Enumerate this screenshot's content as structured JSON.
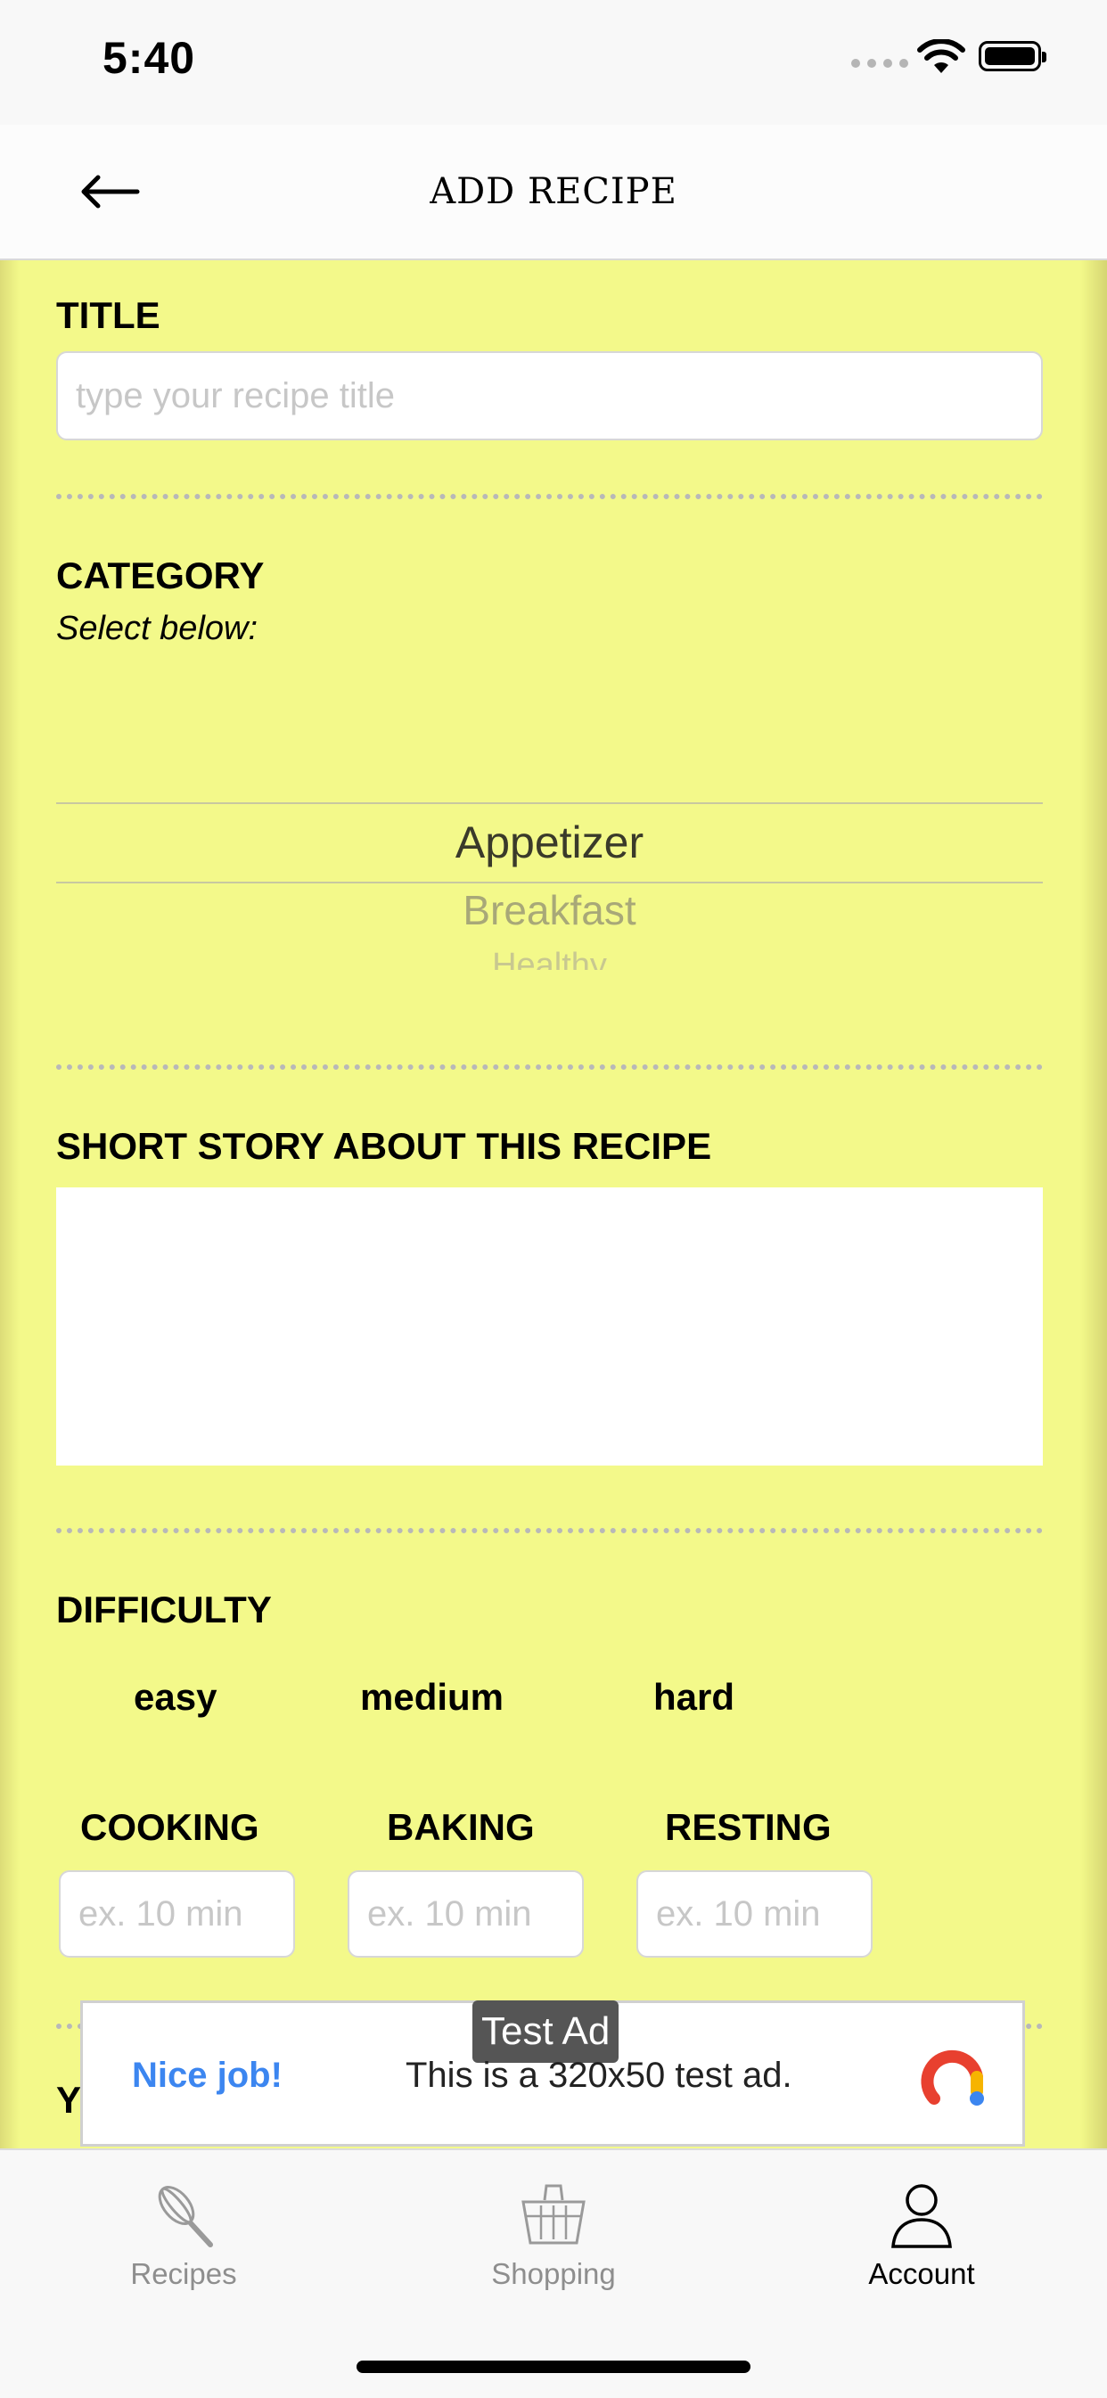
{
  "status_bar": {
    "time": "5:40"
  },
  "header": {
    "back_icon": "arrow-left-icon",
    "title": "ADD RECIPE"
  },
  "form": {
    "title_label": "TITLE",
    "title_placeholder": "type your recipe title",
    "category_label": "CATEGORY",
    "category_hint": "Select below:",
    "category_options": [
      "Appetizer",
      "Breakfast",
      "Healthy"
    ],
    "category_selected": "Appetizer",
    "story_label": "SHORT STORY ABOUT THIS RECIPE",
    "difficulty_label": "DIFFICULTY",
    "difficulty_options": [
      "easy",
      "medium",
      "hard"
    ],
    "times": [
      {
        "label": "COOKING",
        "placeholder": "ex. 10 min"
      },
      {
        "label": "BAKING",
        "placeholder": "ex. 10 min"
      },
      {
        "label": "RESTING",
        "placeholder": "ex. 10 min"
      }
    ],
    "next_section_partial": "Y"
  },
  "ad": {
    "tag": "Test Ad",
    "headline": "Nice job!",
    "text": "This is a 320x50 test ad.",
    "accent": "#3c86f0"
  },
  "tabs": [
    {
      "label": "Recipes",
      "icon": "whisk-icon",
      "active": false
    },
    {
      "label": "Shopping",
      "icon": "basket-icon",
      "active": false
    },
    {
      "label": "Account",
      "icon": "person-icon",
      "active": true
    }
  ],
  "colors": {
    "content_background": "#f3f98a",
    "divider": "#b8b8b8"
  }
}
